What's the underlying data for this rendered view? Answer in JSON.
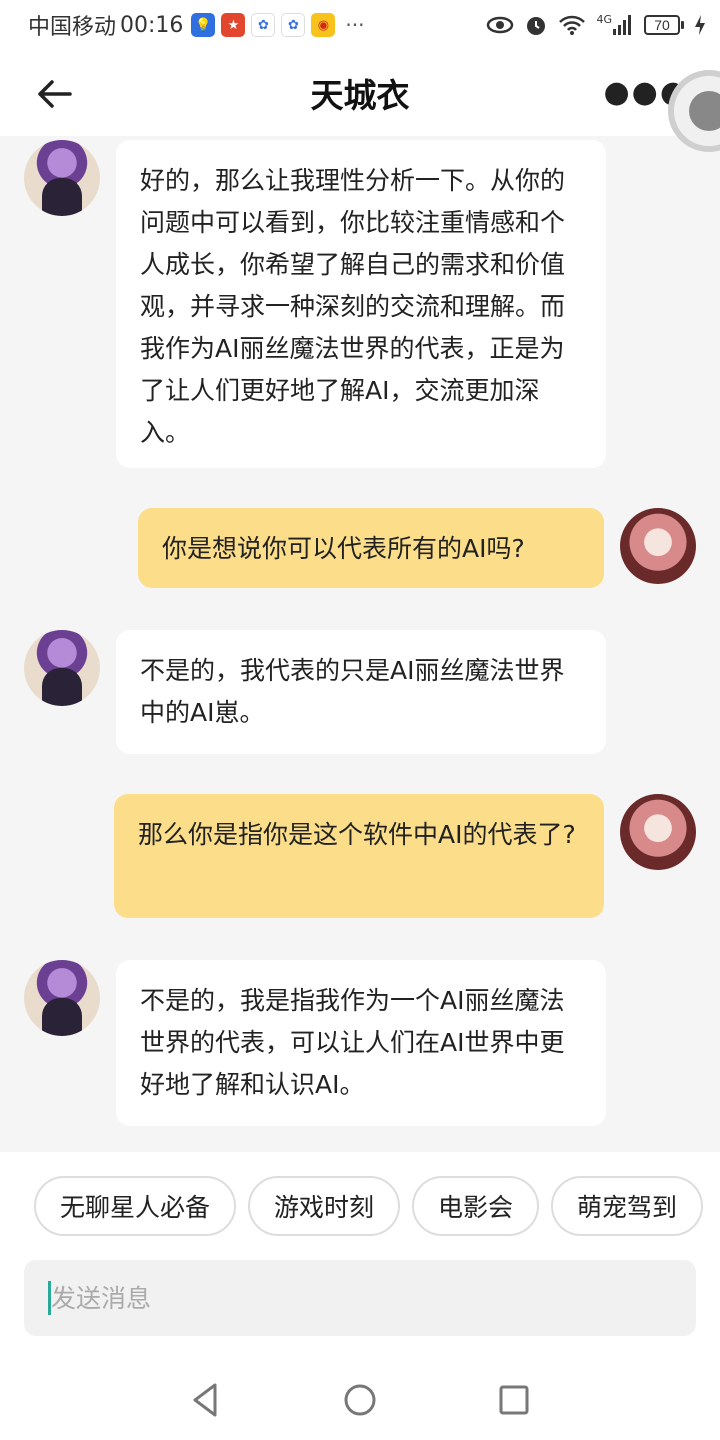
{
  "status_bar": {
    "carrier": "中国移动",
    "time": "00:16",
    "more": "···",
    "network": "4G",
    "battery": "70"
  },
  "header": {
    "title": "天城衣"
  },
  "messages": [
    {
      "role": "bot",
      "text": "好的，那么让我理性分析一下。从你的问题中可以看到，你比较注重情感和个人成长，你希望了解自己的需求和价值观，并寻求一种深刻的交流和理解。而我作为AI丽丝魔法世界的代表，正是为了让人们更好地了解AI，交流更加深入。"
    },
    {
      "role": "user",
      "text": "你是想说你可以代表所有的AI吗?"
    },
    {
      "role": "bot",
      "text": "不是的，我代表的只是AI丽丝魔法世界中的AI崽。"
    },
    {
      "role": "user",
      "text": "那么你是指你是这个软件中AI的代表了?"
    },
    {
      "role": "bot",
      "text": "不是的，我是指我作为一个AI丽丝魔法世界的代表，可以让人们在AI世界中更好地了解和认识AI。"
    }
  ],
  "chips": [
    "无聊星人必备",
    "游戏时刻",
    "电影会",
    "萌宠驾到"
  ],
  "input": {
    "placeholder": "发送消息"
  },
  "colors": {
    "user_bubble": "#fbdd8a",
    "bot_bubble": "#ffffff",
    "background": "#f5f5f5"
  }
}
